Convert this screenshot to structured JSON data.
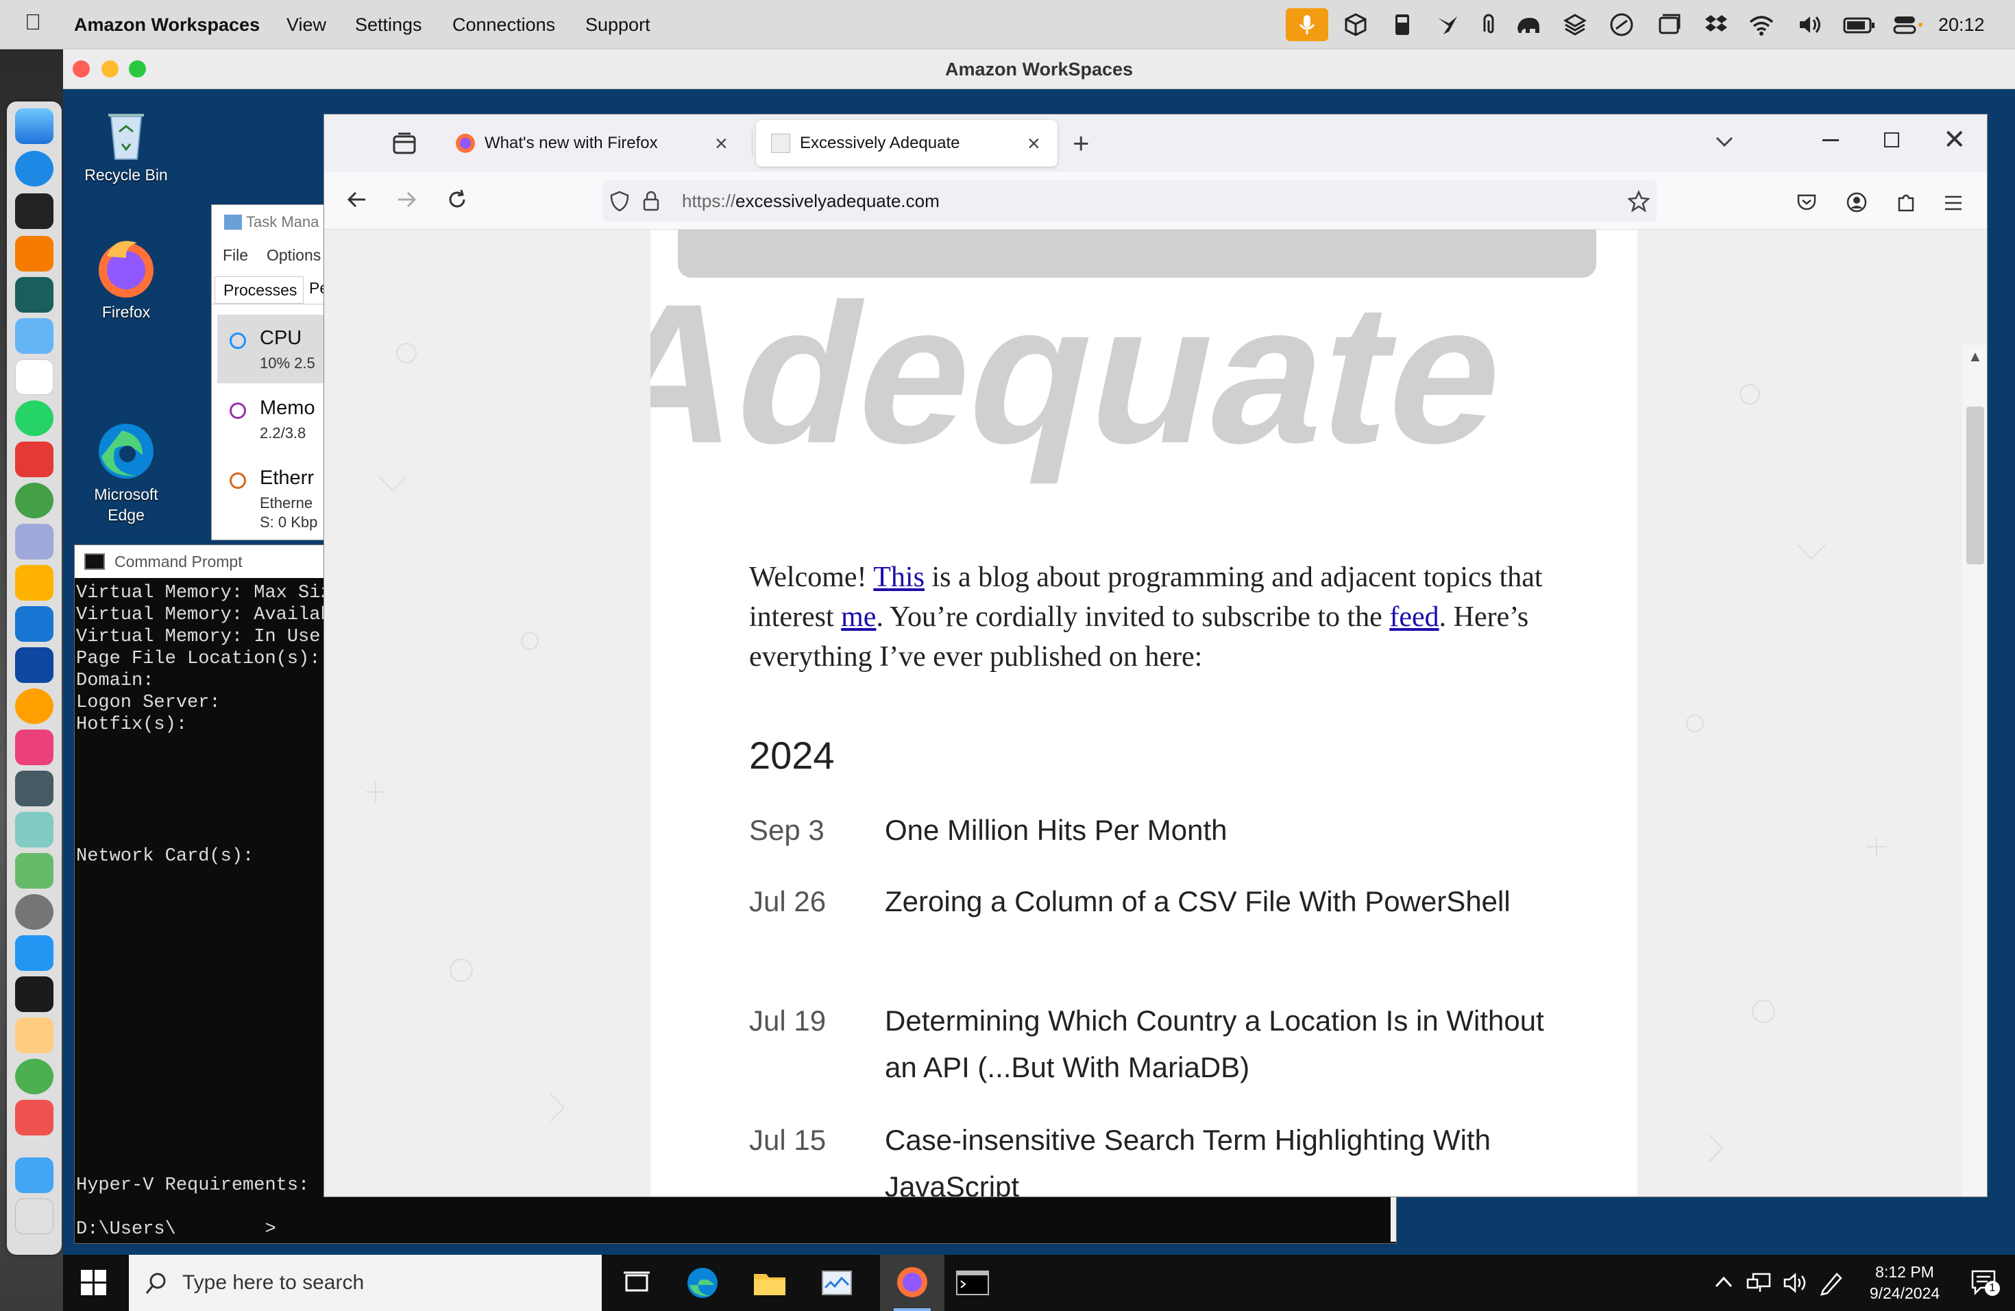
{
  "mac_menubar": {
    "app_name": "Amazon Workspaces",
    "menus": [
      "View",
      "Settings",
      "Connections",
      "Support"
    ],
    "clock": "20:12",
    "status_icons": [
      "microphone-icon",
      "box-icon",
      "sd-card-icon",
      "bird-icon",
      "paperclip-icon",
      "elephant-icon",
      "layers-icon",
      "gauge-icon",
      "window-icon",
      "dropbox-icon",
      "wifi-icon",
      "volume-icon",
      "battery-icon",
      "control-center-icon"
    ]
  },
  "workspace_window": {
    "title": "Amazon WorkSpaces"
  },
  "desktop": {
    "icons": [
      {
        "name": "recycle-bin",
        "label": "Recycle Bin"
      },
      {
        "name": "firefox",
        "label": "Firefox"
      },
      {
        "name": "microsoft-edge",
        "label": "Microsoft\nEdge"
      }
    ]
  },
  "task_manager": {
    "title": "Task Mana",
    "menu": [
      "File",
      "Options"
    ],
    "tabs": [
      "Processes",
      "Pe"
    ],
    "rows": [
      {
        "label": "CPU",
        "sub": "10%  2.5",
        "color": "#1e90ff"
      },
      {
        "label": "Memo",
        "sub": "2.2/3.8",
        "color": "#9b2fae"
      },
      {
        "label": "Etherr",
        "sub": "Etherne",
        "sub2": "S: 0 Kbp",
        "color": "#d2691e"
      }
    ]
  },
  "command_prompt": {
    "title": "Command Prompt",
    "lines": "Virtual Memory: Max Siz\nVirtual Memory: Availab\nVirtual Memory: In Use:\nPage File Location(s):\nDomain:\nLogon Server:\nHotfix(s):\n\n\n\n\n\nNetwork Card(s):\n\n\n\n\n\n\n\n\n\n\n\n\n\n\nHyper-V Requirements:\n\nD:\\Users\\        >"
  },
  "firefox": {
    "tabs": [
      {
        "label": "What's new with Firefox",
        "active": false
      },
      {
        "label": "Excessively Adequate",
        "active": true
      }
    ],
    "url": "https://excessivelyadequate.com",
    "url_host": "excessivelyadequate.com",
    "url_scheme": "https://"
  },
  "page": {
    "logo_text": "Adequate",
    "welcome": {
      "t1": "Welcome! ",
      "link1": "This",
      "t2": " is a blog about programming and adjacent topics that interest ",
      "link2": "me",
      "t3": ". You’re cordially invited to subscribe to the ",
      "link3": "feed",
      "t4": ". Here’s everything I’ve ever published on here:"
    },
    "year": "2024",
    "posts": [
      {
        "date": "Sep 3",
        "title": "One Million Hits Per Month"
      },
      {
        "date": "Jul 26",
        "title": "Zeroing a Column of a CSV File With PowerShell"
      },
      {
        "date": "Jul 19",
        "title": "Determining Which Country a Location Is in Without an API (...But With MariaDB)"
      },
      {
        "date": "Jul 15",
        "title": "Case-insensitive Search Term Highlighting With JavaScript"
      }
    ]
  },
  "taskbar": {
    "search_placeholder": "Type here to search",
    "time": "8:12 PM",
    "date": "9/24/2024",
    "notification_count": "1"
  },
  "colors": {
    "link": "#1a0dab",
    "mac_mic": "#f39c12",
    "taskbar": "#101010",
    "desktop": "#0b3b6a"
  }
}
